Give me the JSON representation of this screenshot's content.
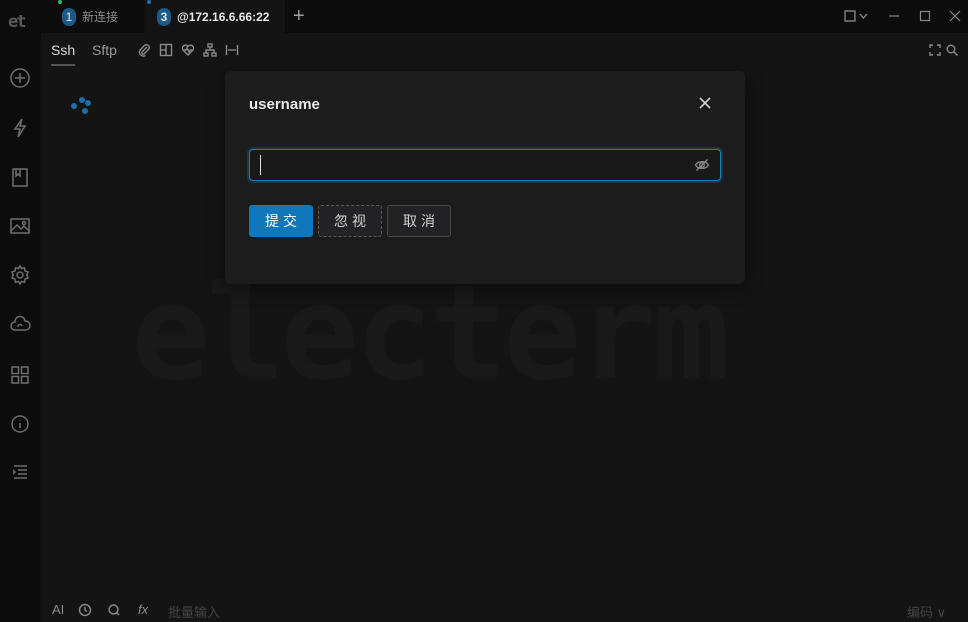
{
  "rail": {
    "logo": "et",
    "icons": [
      "plus-circle-icon",
      "lightning-icon",
      "bookmark-icon",
      "image-icon",
      "gear-icon",
      "cloud-sync-icon",
      "grid-icon",
      "info-icon",
      "list-indent-icon"
    ]
  },
  "tabs": [
    {
      "num": "1",
      "label": "新连接",
      "active": false
    },
    {
      "num": "3",
      "label": "@172.16.6.66:22",
      "active": true
    }
  ],
  "tabbar": {
    "add_label": "+"
  },
  "subtabs": {
    "ssh": "Ssh",
    "sftp": "Sftp"
  },
  "watermark": "electerm",
  "modal": {
    "title": "username",
    "input_value": "",
    "buttons": {
      "submit": "提交",
      "ignore": "忽视",
      "cancel": "取消"
    }
  },
  "bottombar": {
    "ai": "AI",
    "fx": "fx",
    "batch_placeholder": "批量输入",
    "encoding": "编码 ∨"
  },
  "colors": {
    "accent": "#1177bb",
    "background": "#141414",
    "sidebar": "#0c0c0c"
  }
}
